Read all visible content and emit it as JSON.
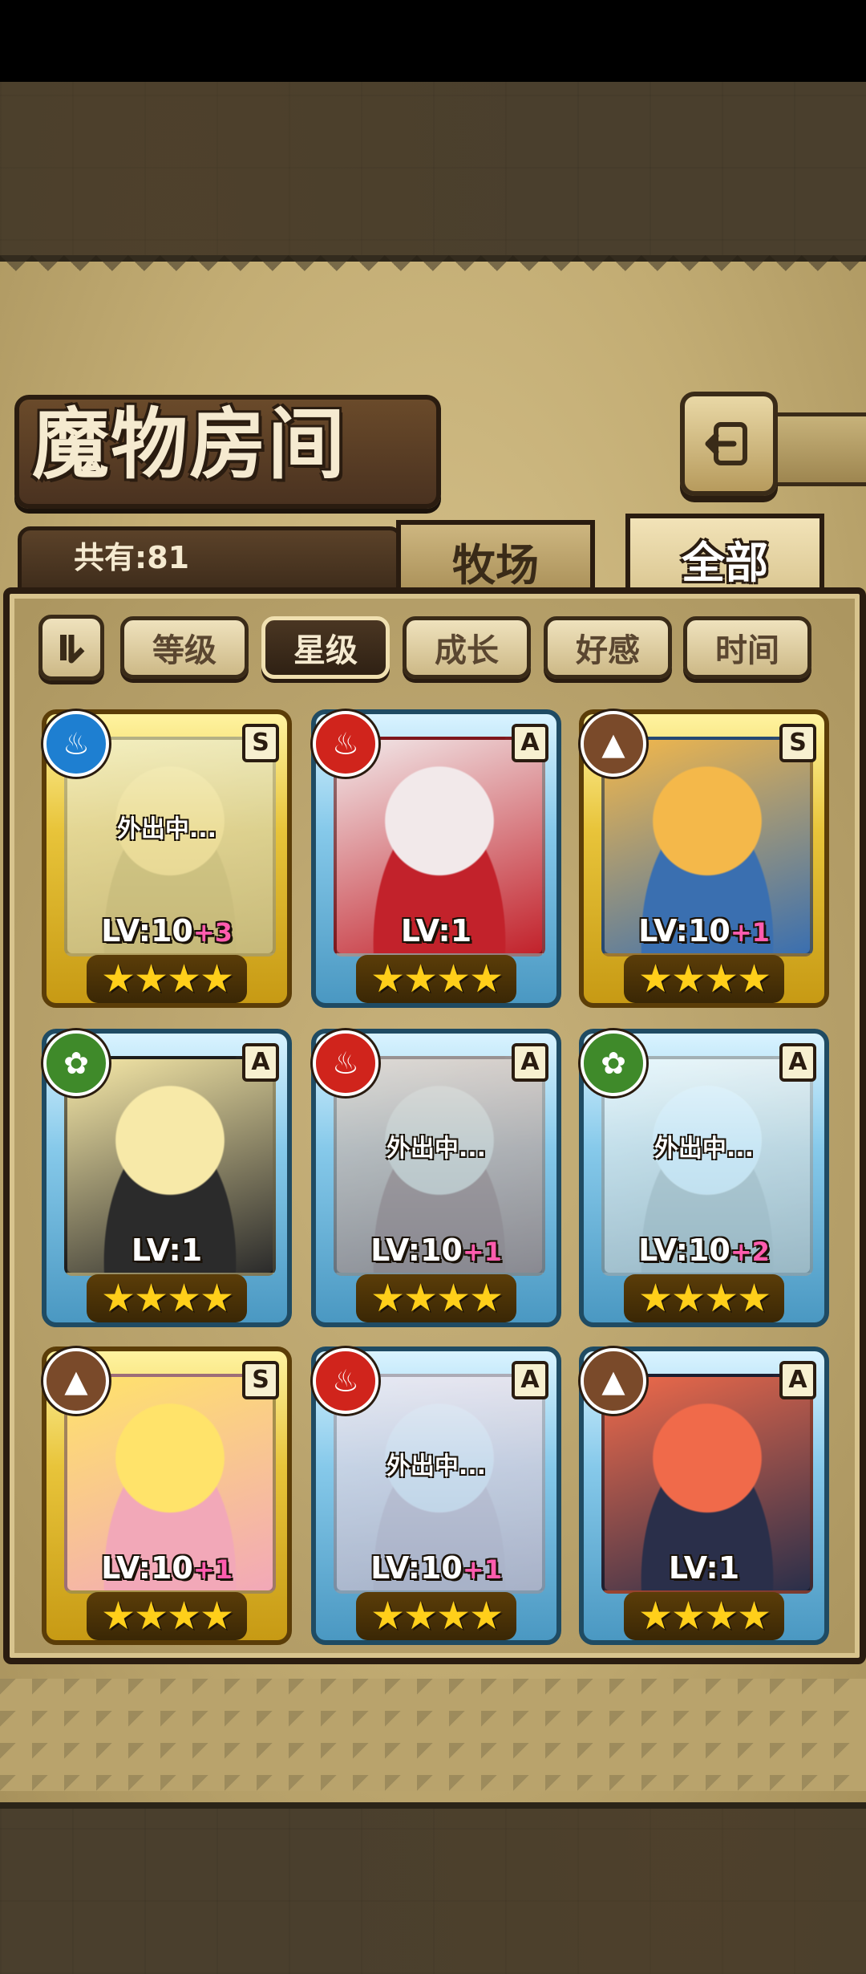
{
  "title": "魔物房间",
  "back_icon": "back-arrow-icon",
  "total": "共有:81",
  "tabs": [
    {
      "label": "牧场",
      "active": false
    },
    {
      "label": "全部",
      "active": true
    }
  ],
  "sort_buttons": [
    {
      "label": "等级",
      "active": false
    },
    {
      "label": "星级",
      "active": true
    },
    {
      "label": "成长",
      "active": false
    },
    {
      "label": "好感",
      "active": false
    },
    {
      "label": "时间",
      "active": false
    }
  ],
  "cards": [
    {
      "rank": "S",
      "element": "water",
      "element_icon": "♨",
      "level": "LV:10",
      "plus": "+3",
      "stars": "★★★★",
      "status": "外出中...",
      "portrait_colors": [
        "#cfd6c4",
        "#9fb0a8"
      ]
    },
    {
      "rank": "A",
      "element": "fire",
      "element_icon": "♨",
      "level": "LV:1",
      "plus": "",
      "stars": "★★★★",
      "status": "",
      "portrait_colors": [
        "#f2e9ea",
        "#c2222b"
      ]
    },
    {
      "rank": "S",
      "element": "earth",
      "element_icon": "▲",
      "level": "LV:10",
      "plus": "+1",
      "stars": "★★★★",
      "status": "",
      "portrait_colors": [
        "#f4b84a",
        "#3a6fb0"
      ]
    },
    {
      "rank": "A",
      "element": "wood",
      "element_icon": "✿",
      "level": "LV:1",
      "plus": "",
      "stars": "★★★★",
      "status": "",
      "portrait_colors": [
        "#f7e9a8",
        "#2b2b2b"
      ]
    },
    {
      "rank": "A",
      "element": "fire",
      "element_icon": "♨",
      "level": "LV:10",
      "plus": "+1",
      "stars": "★★★★",
      "status": "外出中...",
      "portrait_colors": [
        "#e9b08a",
        "#c45a3a"
      ]
    },
    {
      "rank": "A",
      "element": "wood",
      "element_icon": "✿",
      "level": "LV:10",
      "plus": "+2",
      "stars": "★★★★",
      "status": "外出中...",
      "portrait_colors": [
        "#e8e2d8",
        "#b7ad9e"
      ]
    },
    {
      "rank": "S",
      "element": "earth",
      "element_icon": "▲",
      "level": "LV:10",
      "plus": "+1",
      "stars": "★★★★",
      "status": "",
      "portrait_colors": [
        "#ffe36a",
        "#f2a8b8"
      ]
    },
    {
      "rank": "A",
      "element": "fire",
      "element_icon": "♨",
      "level": "LV:10",
      "plus": "+1",
      "stars": "★★★★",
      "status": "外出中...",
      "portrait_colors": [
        "#f3c7cf",
        "#e59aa8"
      ]
    },
    {
      "rank": "A",
      "element": "earth",
      "element_icon": "▲",
      "level": "LV:1",
      "plus": "",
      "stars": "★★★★",
      "status": "",
      "portrait_colors": [
        "#f06a4a",
        "#2a2f4a"
      ]
    }
  ]
}
